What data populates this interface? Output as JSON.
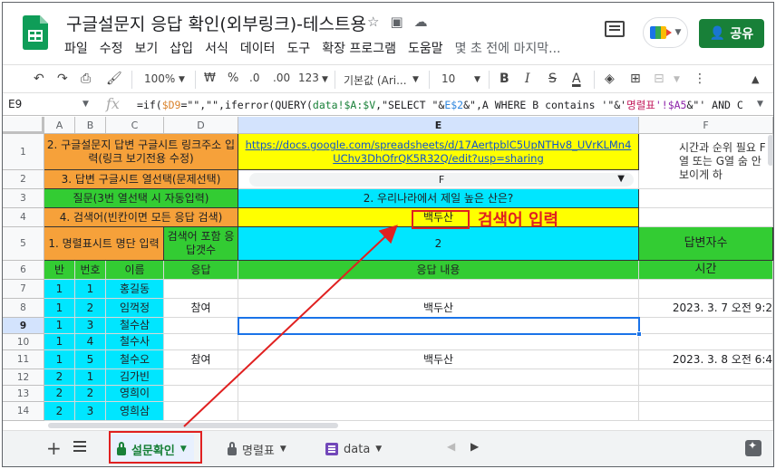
{
  "header": {
    "title": "구글설문지 응답 확인(외부링크)-테스트용",
    "menu": [
      "파일",
      "수정",
      "보기",
      "삽입",
      "서식",
      "데이터",
      "도구",
      "확장 프로그램",
      "도움말"
    ],
    "last_edit": "몇 초 전에 마지막...",
    "share_label": "공유"
  },
  "toolbar": {
    "zoom": "100%",
    "currency": "₩",
    "percent": "%",
    "dec_less": ".0",
    "dec_more": ".00",
    "num_format": "123",
    "font": "기본값 (Ari...",
    "font_size": "10",
    "bold": "B",
    "italic": "I",
    "strike": "S",
    "text_color": "A"
  },
  "formula_bar": {
    "cell_ref": "E9",
    "fx": "fx",
    "p1": "=if(",
    "p2": "$D9",
    "p3": "=\"\",\"\",iferror(QUERY(",
    "p4": "data!$A:$V",
    "p5": ",\"SELECT \"&",
    "p6": "E$2",
    "p7": "&\",A WHERE B contains '\"&'",
    "p8": "명렬표",
    "p9": "'!$A5",
    "p10": "&\"' AND C"
  },
  "columns": [
    "A",
    "B",
    "C",
    "D",
    "E",
    "F"
  ],
  "rows": [
    "1",
    "2",
    "3",
    "4",
    "5",
    "6",
    "7",
    "8",
    "9",
    "10",
    "11",
    "12",
    "13",
    "14"
  ],
  "cells": {
    "r1_label": "2. 구글설문지 답변 구글시트 링크주소 입력(링크 보기전용 수정)",
    "r1_link": "https://docs.google.com/spreadsheets/d/17AertpblC5UpNTHv8_UVrKLMn4UChv3DhOfrQK5R32Q/edit?usp=sharing",
    "r1_note": "시간과 순위 필요 F열 또는 G열 숨 안 보이게 하",
    "r2_label": "3. 답변 구글시트 열선택(문제선택)",
    "r2_value": "F",
    "r3_label": "질문(3번 열선택 시 자동입력)",
    "r3_value": "2. 우리나라에서 제일 높은 산은?",
    "r4_label": "4. 검색어(빈칸이면 모든 응답 검색)",
    "r4_value": "백두산",
    "r5_label": "1. 명렬표시트 명단 입력",
    "r5_d": "검색어 포함 응답갯수",
    "r5_e": "2",
    "r5_f": "답변자수",
    "h_class": "반",
    "h_no": "번호",
    "h_name": "이름",
    "h_resp": "응답",
    "h_content": "응답 내용",
    "h_time": "시간"
  },
  "students": [
    {
      "cls": "1",
      "no": "1",
      "name": "홍길동",
      "resp": "",
      "content": "",
      "time": ""
    },
    {
      "cls": "1",
      "no": "2",
      "name": "임꺽정",
      "resp": "참여",
      "content": "백두산",
      "time": "2023. 3. 7 오전 9:2"
    },
    {
      "cls": "1",
      "no": "3",
      "name": "철수삼",
      "resp": "",
      "content": "",
      "time": ""
    },
    {
      "cls": "1",
      "no": "4",
      "name": "철수사",
      "resp": "",
      "content": "",
      "time": ""
    },
    {
      "cls": "1",
      "no": "5",
      "name": "철수오",
      "resp": "참여",
      "content": "백두산",
      "time": "2023. 3. 8 오전 6:4"
    },
    {
      "cls": "2",
      "no": "1",
      "name": "김가빈",
      "resp": "",
      "content": "",
      "time": ""
    },
    {
      "cls": "2",
      "no": "2",
      "name": "영희이",
      "resp": "",
      "content": "",
      "time": ""
    },
    {
      "cls": "2",
      "no": "3",
      "name": "영희삼",
      "resp": "",
      "content": "",
      "time": ""
    }
  ],
  "annotation": {
    "text": "검색어 입력",
    "color": "#e02020"
  },
  "sheets": [
    {
      "label": "설문확인",
      "active": true
    },
    {
      "label": "명렬표",
      "active": false
    },
    {
      "label": "data",
      "active": false
    }
  ],
  "colors": {
    "orange": "#f6a13a",
    "yellow": "#ffff00",
    "green": "#33cc33",
    "cyan": "#00e6ff",
    "share": "#188038",
    "selection": "#1a73e8"
  }
}
